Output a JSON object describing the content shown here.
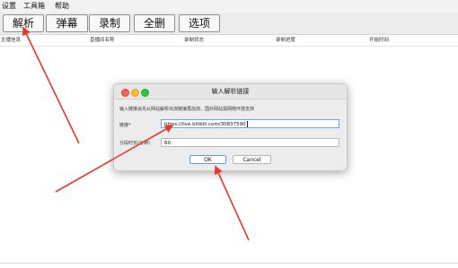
{
  "menu": {
    "items": [
      {
        "label": "设置"
      },
      {
        "label": "工具箱"
      },
      {
        "label": "帮助"
      }
    ]
  },
  "toolbar": {
    "buttons": [
      {
        "label": "解析"
      },
      {
        "label": "弹幕"
      },
      {
        "label": "录制"
      },
      {
        "label": "全删"
      },
      {
        "label": "选项"
      }
    ]
  },
  "table": {
    "columns": [
      "主播信息",
      "直播间名称",
      "录制状态",
      "录制进度",
      "开始时间"
    ]
  },
  "dialog": {
    "title": "输入解析链接",
    "hint": "输入链接会先从网站解析出流链接再加流，国外网站需网络环境支持",
    "link_label": "链接*",
    "link_value": "https://live.bilibili.com/30837590",
    "segment_label": "分段时长(分钟)",
    "segment_value": "60",
    "ok_label": "OK",
    "cancel_label": "Cancel"
  },
  "colors": {
    "annotation_arrow": "#e23b2e",
    "focus_ring": "#5e9ee6"
  }
}
